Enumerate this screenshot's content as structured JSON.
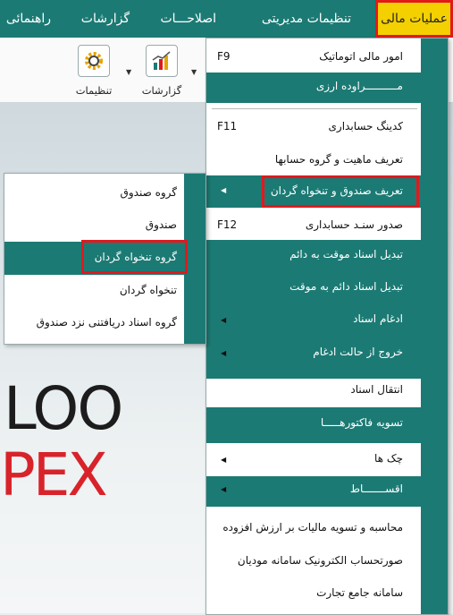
{
  "menubar": {
    "items": [
      {
        "label": "عملیات مالی"
      },
      {
        "label": "تنظیمات مدیریتی"
      },
      {
        "label": "اصلاحـــات"
      },
      {
        "label": "گزارشات"
      },
      {
        "label": "راهنمائی"
      }
    ]
  },
  "toolbar": {
    "settings_label": "تنظیمات",
    "reports_label": "گزارشات"
  },
  "background_logo": {
    "line1": "LOO",
    "line2": "PEX"
  },
  "financial_menu": {
    "items": [
      {
        "label": "امور مالی اتوماتیک",
        "shortcut": "F9"
      },
      {
        "label": "مــــــــــراوده ارزی"
      },
      {
        "label": "کدینگ حسابداری",
        "shortcut": "F11"
      },
      {
        "label": "تعریف ماهیت و گروه حسابها"
      },
      {
        "label": "تعریف صندوق و تنخواه گردان"
      },
      {
        "label": "صدور سنـد حسابداری",
        "shortcut": "F12"
      },
      {
        "label": "تبدیل اسناد موقت به دائم"
      },
      {
        "label": "تبدیل اسناد دائم به موقت"
      },
      {
        "label": "ادغام اسناد"
      },
      {
        "label": "خروج از حالت ادغام"
      },
      {
        "label": "انتقال اسناد"
      },
      {
        "label": "تسویه فاکتورهـــــا"
      },
      {
        "label": "چک ها"
      },
      {
        "label": "اقســـــــاط"
      },
      {
        "label": "محاسبه و تسویه مالیات بر ارزش افزوده"
      },
      {
        "label": "صورتحساب الکترونیک سامانه مودیان"
      },
      {
        "label": "سامانه جامع تجارت"
      }
    ]
  },
  "fund_submenu": {
    "items": [
      {
        "label": "گروه صندوق"
      },
      {
        "label": "صندوق"
      },
      {
        "label": "گروه تنخواه گردان"
      },
      {
        "label": "تنخواه گردان"
      },
      {
        "label": "گروه اسناد دریافتنی نزد صندوق"
      }
    ]
  }
}
